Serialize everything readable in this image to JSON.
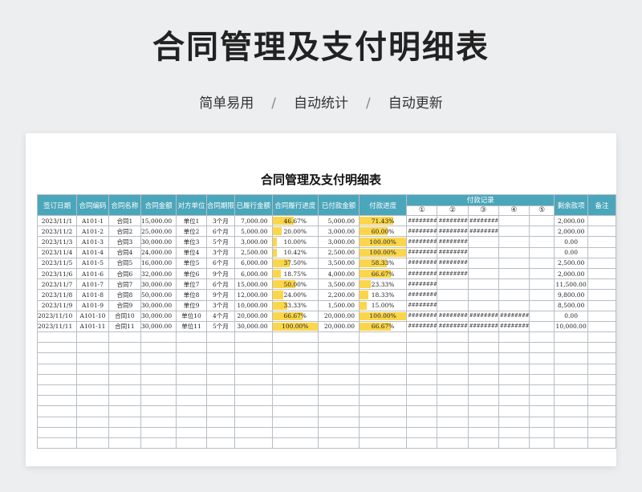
{
  "header": {
    "title": "合同管理及支付明细表",
    "tags": [
      "简单易用",
      "自动统计",
      "自动更新"
    ],
    "separator": "/"
  },
  "sheet": {
    "title": "合同管理及支付明细表",
    "columns": [
      "签订日期",
      "合同编码",
      "合同名称",
      "合同金额",
      "对方单位",
      "合同期限",
      "已履行金额",
      "合同履行进度",
      "已付款金额",
      "付款进度",
      "付款记录",
      "剩余款项",
      "备注"
    ],
    "record_columns": [
      "①",
      "②",
      "③",
      "④",
      "⑤"
    ],
    "record_mask": "########",
    "bar_color": "#fbd64a",
    "header_color": "#4aa6bb",
    "empty_rows": 11,
    "rows": [
      {
        "date": "2023/11/1",
        "code": "A101-1",
        "name": "合同1",
        "amount": "15,000.00",
        "party": "单位1",
        "term": "3个月",
        "performed": "7,000.00",
        "perf_pct": "46.67%",
        "perf": 0.4667,
        "paid": "5,000.00",
        "pay_pct": "71.43%",
        "pay": 0.7143,
        "records": 3,
        "remaining": "2,000.00",
        "note": ""
      },
      {
        "date": "2023/11/2",
        "code": "A101-2",
        "name": "合同2",
        "amount": "25,000.00",
        "party": "单位2",
        "term": "6个月",
        "performed": "5,000.00",
        "perf_pct": "20.00%",
        "perf": 0.2,
        "paid": "3,000.00",
        "pay_pct": "60.00%",
        "pay": 0.6,
        "records": 3,
        "remaining": "2,000.00",
        "note": ""
      },
      {
        "date": "2023/11/3",
        "code": "A101-3",
        "name": "合同3",
        "amount": "30,000.00",
        "party": "单位3",
        "term": "5个月",
        "performed": "3,000.00",
        "perf_pct": "10.00%",
        "perf": 0.1,
        "paid": "3,000.00",
        "pay_pct": "100.00%",
        "pay": 1.0,
        "records": 2,
        "remaining": "0.00",
        "note": ""
      },
      {
        "date": "2023/11/4",
        "code": "A101-4",
        "name": "合同4",
        "amount": "24,000.00",
        "party": "单位4",
        "term": "3个月",
        "performed": "2,500.00",
        "perf_pct": "10.42%",
        "perf": 0.1042,
        "paid": "2,500.00",
        "pay_pct": "100.00%",
        "pay": 1.0,
        "records": 2,
        "remaining": "0.00",
        "note": ""
      },
      {
        "date": "2023/11/5",
        "code": "A101-5",
        "name": "合同5",
        "amount": "16,000.00",
        "party": "单位5",
        "term": "6个月",
        "performed": "6,000.00",
        "perf_pct": "37.50%",
        "perf": 0.375,
        "paid": "3,500.00",
        "pay_pct": "58.33%",
        "pay": 0.5833,
        "records": 2,
        "remaining": "2,500.00",
        "note": ""
      },
      {
        "date": "2023/11/6",
        "code": "A101-6",
        "name": "合同6",
        "amount": "32,000.00",
        "party": "单位6",
        "term": "9个月",
        "performed": "6,000.00",
        "perf_pct": "18.75%",
        "perf": 0.1875,
        "paid": "4,000.00",
        "pay_pct": "66.67%",
        "pay": 0.6667,
        "records": 2,
        "remaining": "2,000.00",
        "note": ""
      },
      {
        "date": "2023/11/7",
        "code": "A101-7",
        "name": "合同7",
        "amount": "30,000.00",
        "party": "单位7",
        "term": "6个月",
        "performed": "15,000.00",
        "perf_pct": "50.00%",
        "perf": 0.5,
        "paid": "3,500.00",
        "pay_pct": "23.33%",
        "pay": 0.2333,
        "records": 1,
        "remaining": "11,500.00",
        "note": ""
      },
      {
        "date": "2023/11/8",
        "code": "A101-8",
        "name": "合同8",
        "amount": "50,000.00",
        "party": "单位8",
        "term": "9个月",
        "performed": "12,000.00",
        "perf_pct": "24.00%",
        "perf": 0.24,
        "paid": "2,200.00",
        "pay_pct": "18.33%",
        "pay": 0.1833,
        "records": 1,
        "remaining": "9,800.00",
        "note": ""
      },
      {
        "date": "2023/11/9",
        "code": "A101-9",
        "name": "合同9",
        "amount": "30,000.00",
        "party": "单位9",
        "term": "3个月",
        "performed": "10,000.00",
        "perf_pct": "33.33%",
        "perf": 0.3333,
        "paid": "1,500.00",
        "pay_pct": "15.00%",
        "pay": 0.15,
        "records": 1,
        "remaining": "8,500.00",
        "note": ""
      },
      {
        "date": "2023/11/10",
        "code": "A101-10",
        "name": "合同10",
        "amount": "30,000.00",
        "party": "单位10",
        "term": "4个月",
        "performed": "20,000.00",
        "perf_pct": "66.67%",
        "perf": 0.6667,
        "paid": "20,000.00",
        "pay_pct": "100.00%",
        "pay": 1.0,
        "records": 4,
        "remaining": "0.00",
        "note": ""
      },
      {
        "date": "2023/11/11",
        "code": "A101-11",
        "name": "合同11",
        "amount": "30,000.00",
        "party": "单位11",
        "term": "5个月",
        "performed": "30,000.00",
        "perf_pct": "100.00%",
        "perf": 1.0,
        "paid": "20,000.00",
        "pay_pct": "66.67%",
        "pay": 0.6667,
        "records": 4,
        "remaining": "10,000.00",
        "note": ""
      }
    ]
  }
}
